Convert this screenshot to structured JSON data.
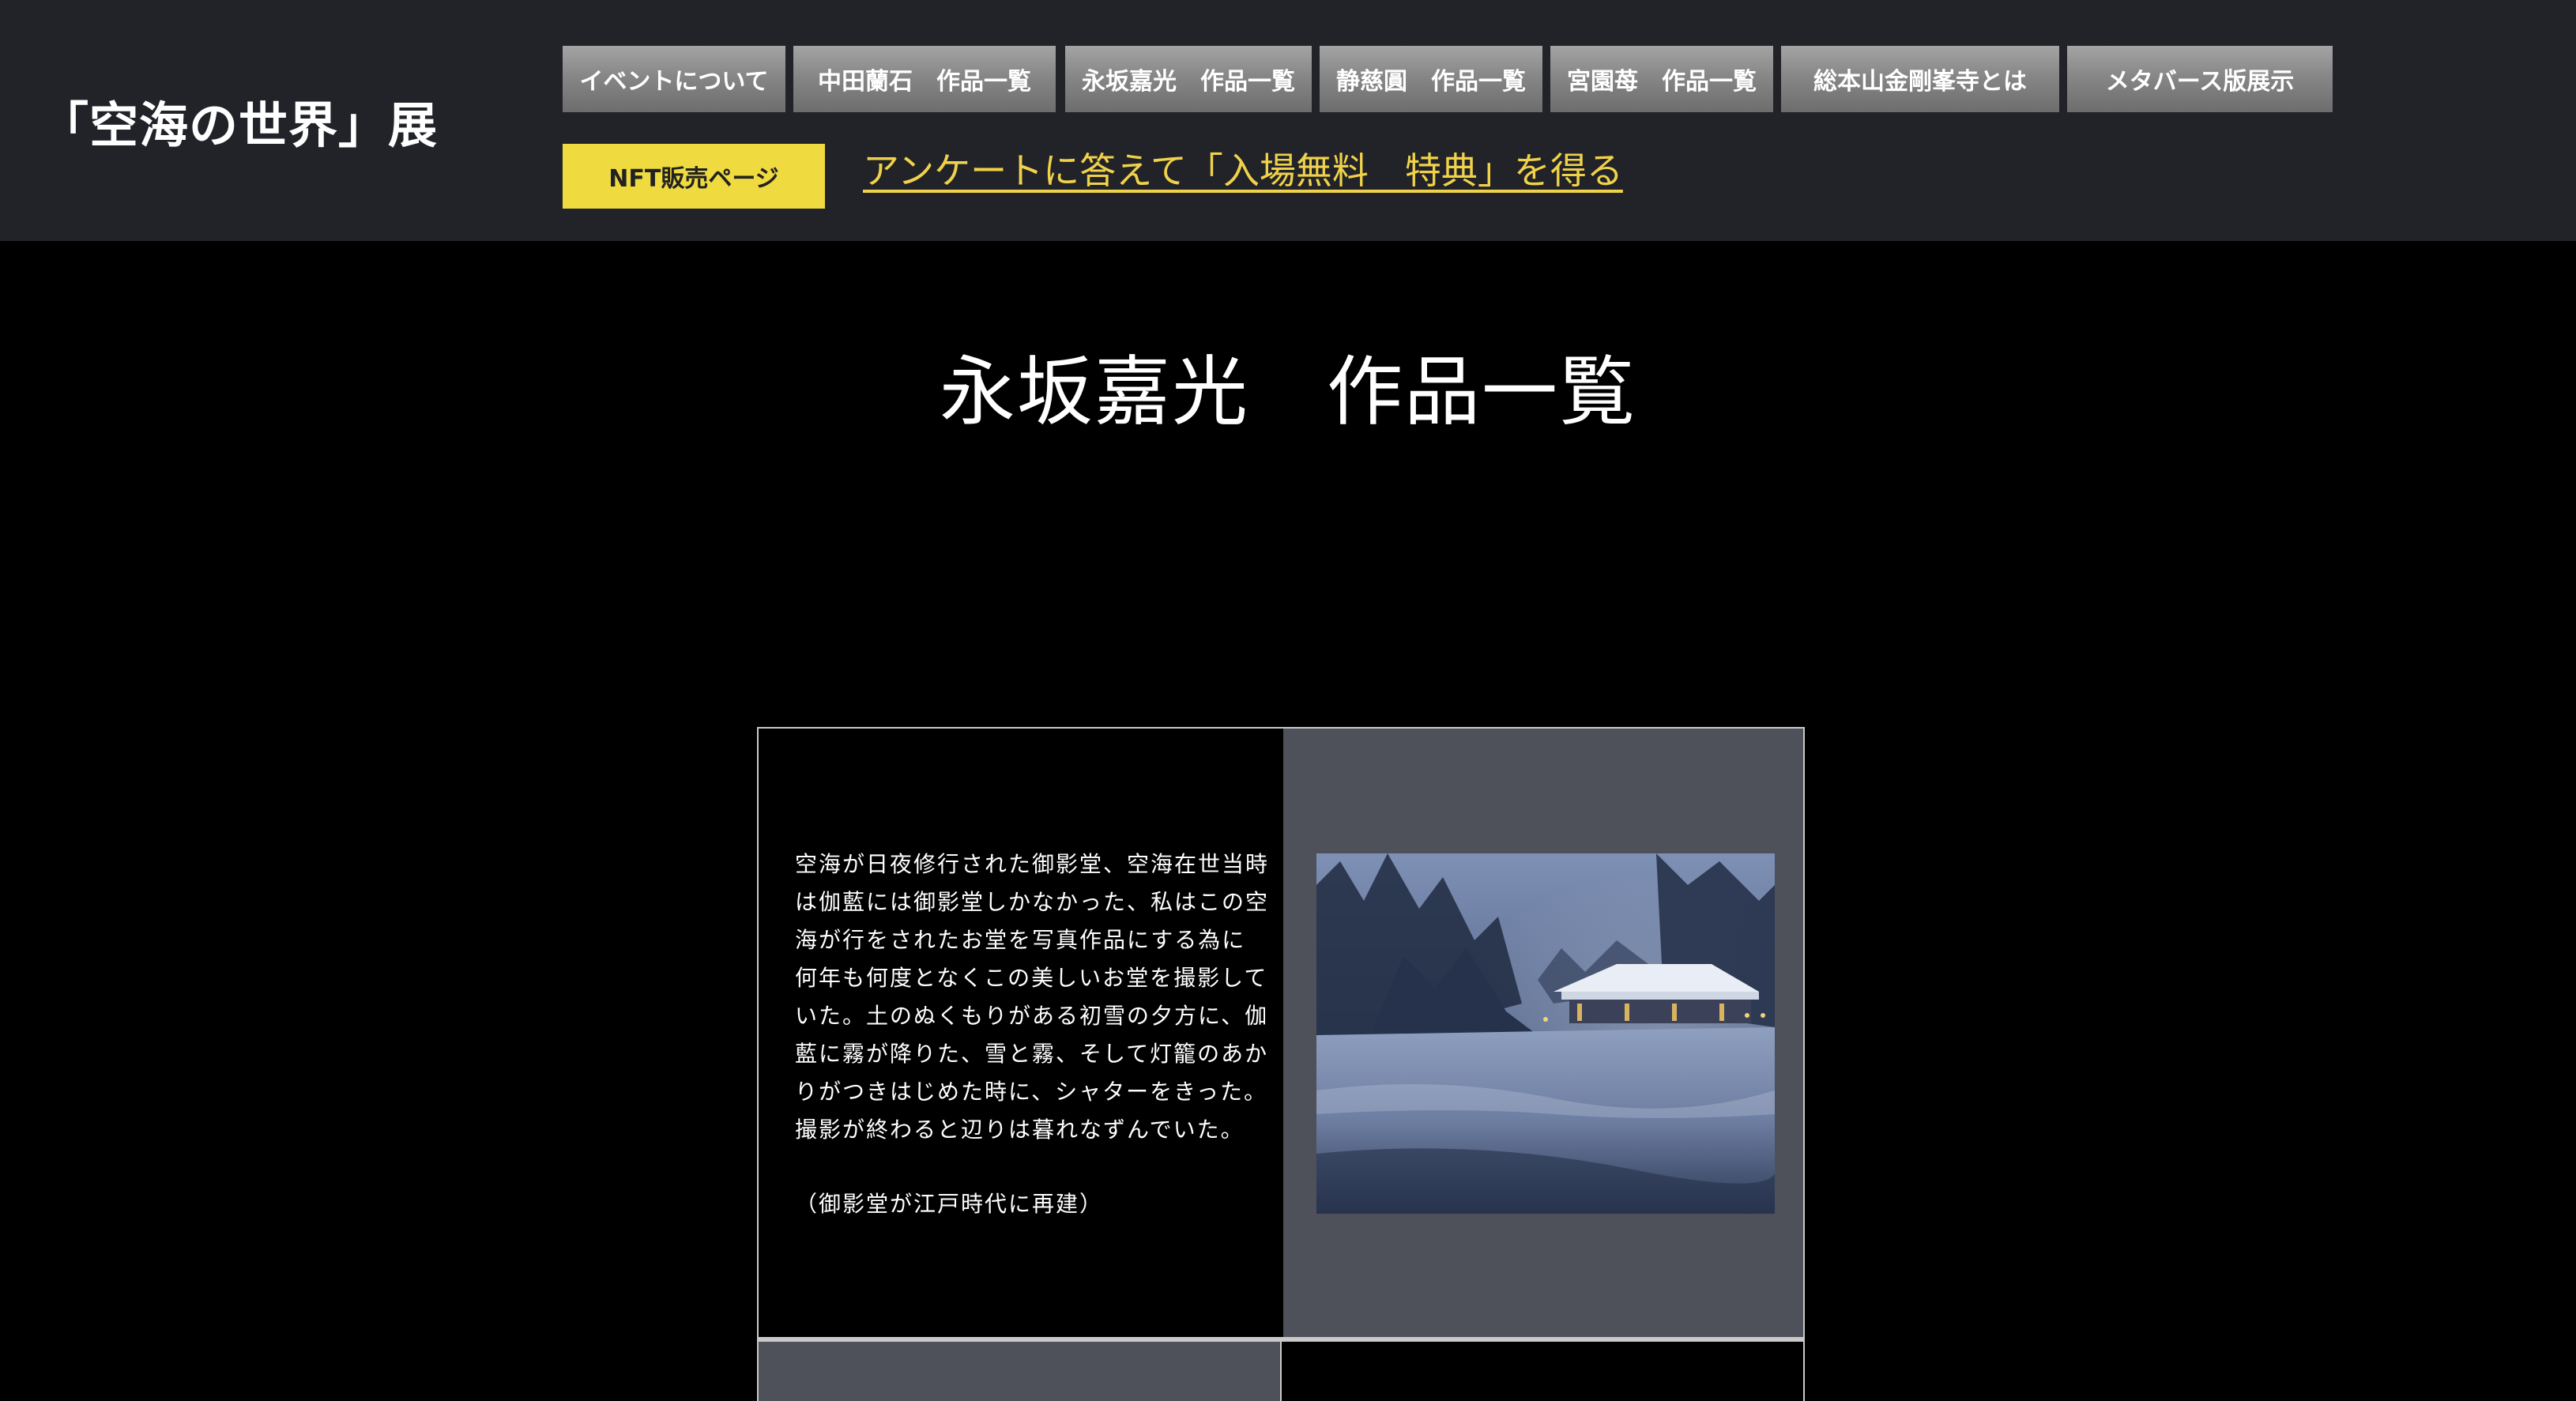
{
  "header": {
    "site_title": "「空海の世界」展",
    "nav": [
      {
        "label": "イベントについて"
      },
      {
        "label": "中田蘭石　作品一覧"
      },
      {
        "label": "永坂嘉光　作品一覧"
      },
      {
        "label": "静慈圓　作品一覧"
      },
      {
        "label": "宮園苺　作品一覧"
      },
      {
        "label": "総本山金剛峯寺とは"
      },
      {
        "label": "メタバース版展示"
      }
    ],
    "nft_button": "NFT販売ページ",
    "survey_link": "アンケートに答えて「入場無料　特典」を得る"
  },
  "main": {
    "page_title": "永坂嘉光　作品一覧",
    "works": [
      {
        "description": "空海が日夜修行された御影堂、空海在世当時は伽藍には御影堂しかなかった、私はこの空海が行をされたお堂を写真作品にする為に何年も何度となくこの美しいお堂を撮影していた。土のぬくもりがある初雪の夕方に、伽藍に霧が降りた、雪と霧、そして灯籠のあかりがつきはじめた時に、シャターをきった。撮影が終わると辺りは暮れなずんでいた。",
        "note": "（御影堂が江戸時代に再建）"
      }
    ]
  },
  "colors": {
    "header_bg": "#212328",
    "page_bg": "#000000",
    "nav_button": "#878787",
    "nft_button": "#efdb3f",
    "survey_link": "#f0d24a",
    "image_cell_bg": "#4e505a"
  }
}
